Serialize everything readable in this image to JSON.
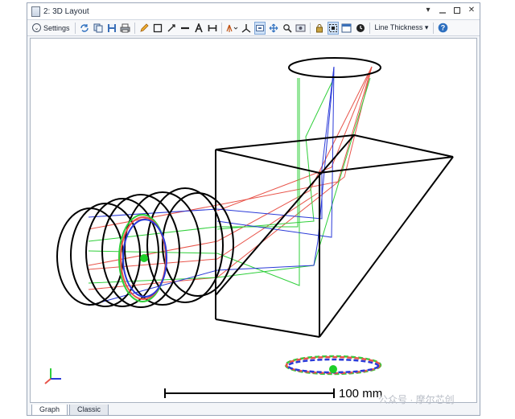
{
  "window": {
    "title": "2: 3D Layout"
  },
  "title_controls": {
    "dropdown": "▾",
    "close": "✕"
  },
  "toolbar": {
    "settings_label": "Settings",
    "settings_icon": "⌄",
    "line_thickness_label": "Line Thickness ▾",
    "help_icon": "?"
  },
  "viewport": {
    "scale_label": "100 mm"
  },
  "tabs": [
    {
      "label": "Graph"
    },
    {
      "label": "Classic"
    }
  ],
  "watermark": {
    "text": "公众号 · 摩尔芯创"
  },
  "colors": {
    "ray_red": "#e8544a",
    "ray_green": "#2fcf3a",
    "ray_blue": "#2a3ad8",
    "geometry": "#000000"
  }
}
